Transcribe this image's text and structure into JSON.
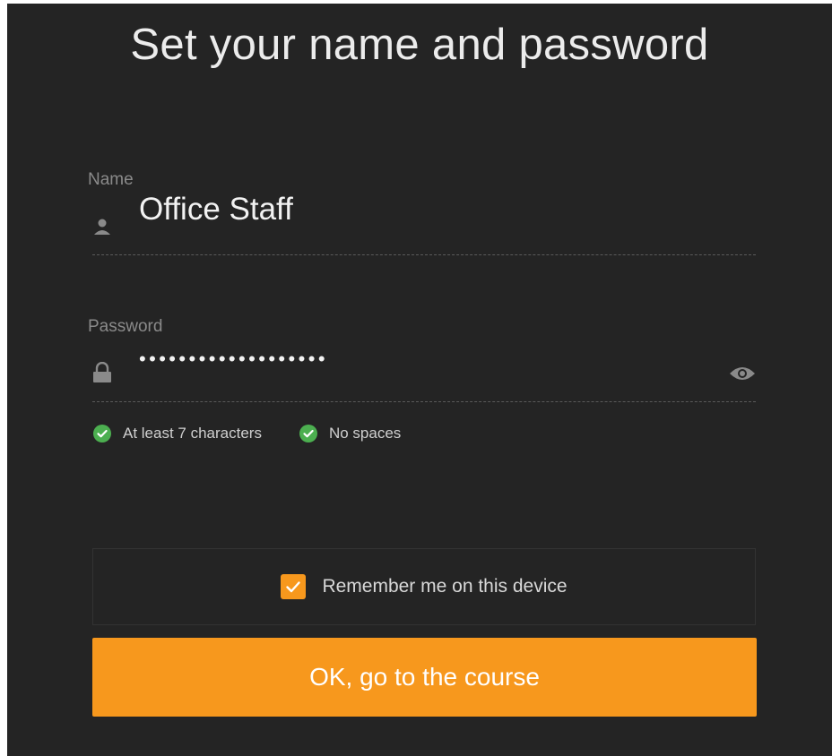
{
  "title": "Set your name and password",
  "name_field": {
    "label": "Name",
    "value": "Office Staff",
    "icon": "person-icon"
  },
  "password_field": {
    "label": "Password",
    "masked_value": "•••••••••••••••••••",
    "icon": "lock-icon",
    "toggle_icon": "eye-icon"
  },
  "rules": [
    {
      "label": "At least 7 characters",
      "satisfied": true
    },
    {
      "label": "No spaces",
      "satisfied": true
    }
  ],
  "remember": {
    "label": "Remember me on this device",
    "checked": true
  },
  "submit": {
    "label": "OK, go to the course"
  },
  "colors": {
    "background": "#242424",
    "accent": "#f7981d",
    "success": "#4caf50"
  }
}
